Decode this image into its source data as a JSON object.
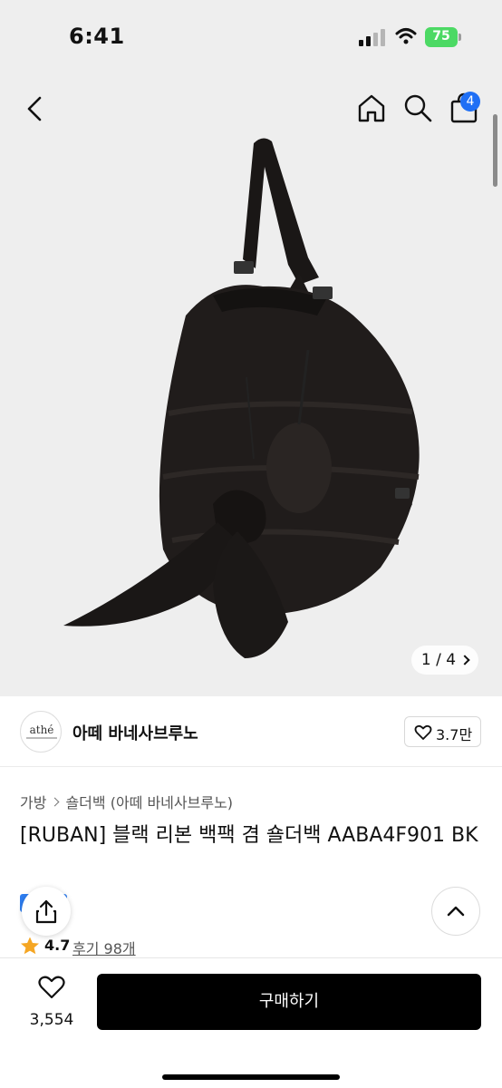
{
  "status_bar": {
    "time": "6:41",
    "battery": "75"
  },
  "nav": {
    "cart_badge": "4"
  },
  "gallery": {
    "current": "1",
    "total": "4",
    "separator": " / "
  },
  "brand": {
    "logo_text": "athé",
    "name": "아떼 바네사브루노",
    "likes": "3.7만"
  },
  "breadcrumb": {
    "level1": "가방",
    "level2": "숄더백 (아떼 바네사브루노)"
  },
  "product": {
    "title": "[RUBAN] 블랙 리본 백팩 겸 숄더백 AABA4F901 BK"
  },
  "rating": {
    "value": "4.7",
    "review_label": "후기 98개"
  },
  "bottom_bar": {
    "wish_count": "3,554",
    "buy_label": "구매하기"
  },
  "colors": {
    "accent": "#1f6ff5",
    "battery": "#4cd964",
    "buy_button": "#000000",
    "star": "#f5a623"
  },
  "icons": [
    "back-icon",
    "home-icon",
    "search-icon",
    "cart-icon",
    "heart-icon",
    "share-icon",
    "chevron-up-icon",
    "star-icon"
  ]
}
